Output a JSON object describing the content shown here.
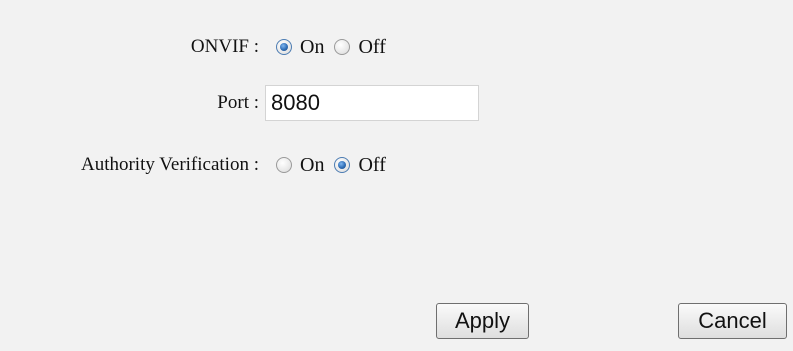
{
  "onvif": {
    "label": "ONVIF :",
    "options": [
      {
        "label": "On",
        "checked": true
      },
      {
        "label": "Off",
        "checked": false
      }
    ]
  },
  "port": {
    "label": "Port :",
    "value": "8080"
  },
  "authority": {
    "label": "Authority Verification :",
    "options": [
      {
        "label": "On",
        "checked": false
      },
      {
        "label": "Off",
        "checked": true
      }
    ]
  },
  "buttons": {
    "apply": "Apply",
    "cancel": "Cancel"
  }
}
